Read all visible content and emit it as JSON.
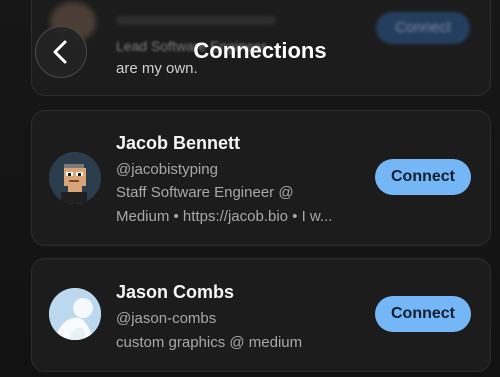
{
  "header": {
    "title": "Connections"
  },
  "previous_card": {
    "text_line": "are my own.",
    "faded_line": "Lead Software Engineer",
    "button_label": "Connect"
  },
  "connections": [
    {
      "name": "Jacob Bennett",
      "handle": "@jacobistyping",
      "bio_line1": "Staff Software Engineer @",
      "bio_line2": "Medium • https://jacob.bio • I w...",
      "button_label": "Connect"
    },
    {
      "name": "Jason Combs",
      "handle": "@jason-combs",
      "bio_line1": "custom graphics @ medium",
      "button_label": "Connect"
    }
  ],
  "colors": {
    "background": "#141414",
    "card": "#1c1c1c",
    "accent_button": "#75b6f7",
    "button_text": "#0d1d30"
  },
  "icons": {
    "back": "chevron-left-icon"
  }
}
